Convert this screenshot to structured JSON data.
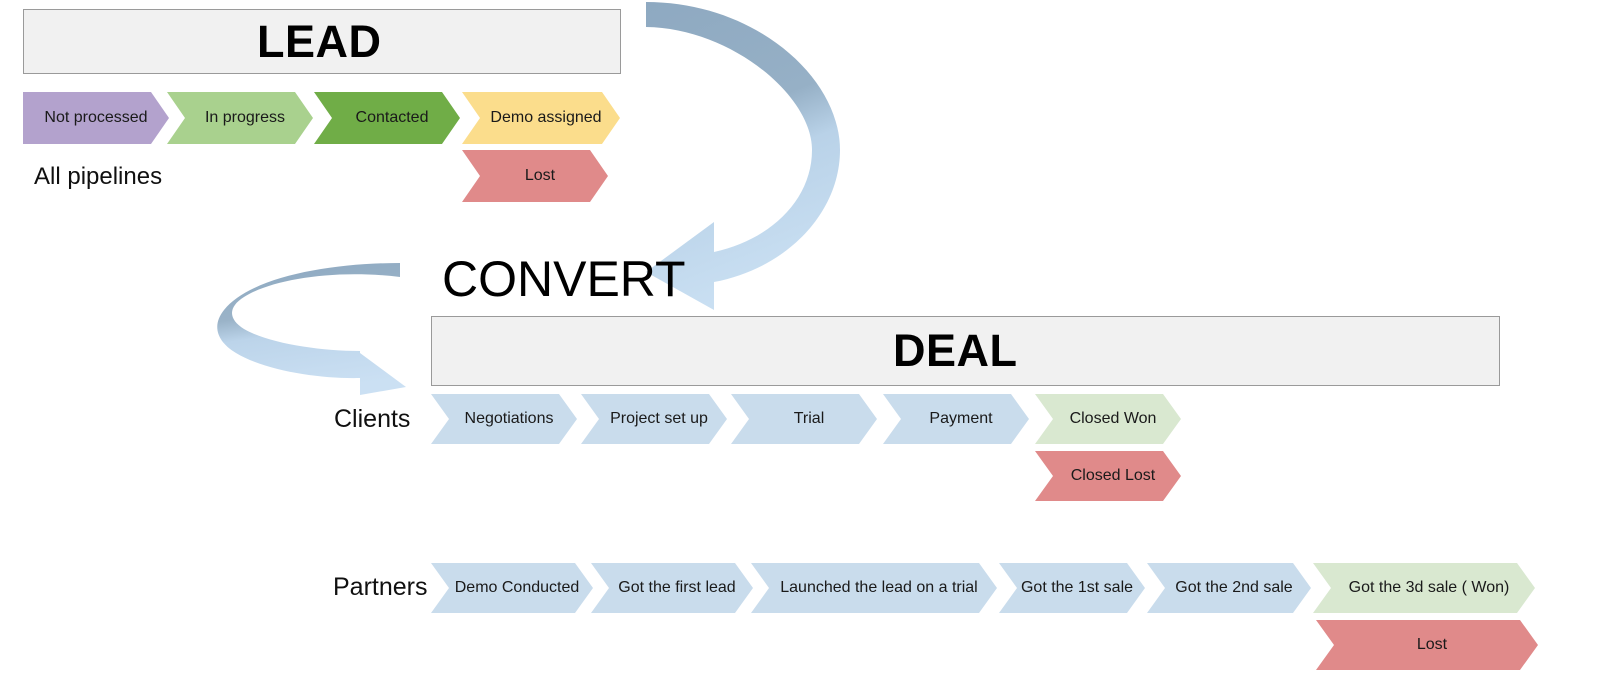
{
  "diagram": {
    "title_words": {
      "lead": "LEAD",
      "convert": "CONVERT",
      "deal": "DEAL"
    },
    "row_labels": {
      "all_pipelines": "All pipelines",
      "clients": "Clients",
      "partners": "Partners"
    },
    "colors": {
      "purple": "#b3a2cd",
      "light_green": "#a9d18e",
      "dark_green": "#70ad47",
      "yellow": "#fbdd8c",
      "red": "#e08a8a",
      "blue": "#c9dcec",
      "pale_green": "#d9e8d0",
      "box_fill": "#f1f1f1",
      "box_border": "#9a9a9a",
      "arrow_dark": "#8ea9c1",
      "arrow_light": "#c5dcf0"
    },
    "lead_stages": [
      {
        "label": "Not processed",
        "color": "#b3a2cd"
      },
      {
        "label": "In progress",
        "color": "#a9d18e"
      },
      {
        "label": "Contacted",
        "color": "#70ad47"
      },
      {
        "label": "Demo assigned",
        "color": "#fbdd8c"
      }
    ],
    "lead_lost": {
      "label": "Lost",
      "color": "#e08a8a"
    },
    "client_stages": [
      {
        "label": "Negotiations",
        "color": "#c9dcec"
      },
      {
        "label": "Project set up",
        "color": "#c9dcec"
      },
      {
        "label": "Trial",
        "color": "#c9dcec"
      },
      {
        "label": "Payment",
        "color": "#c9dcec"
      },
      {
        "label": "Closed Won",
        "color": "#d9e8d0"
      }
    ],
    "client_lost": {
      "label": "Closed Lost",
      "color": "#e08a8a"
    },
    "partner_stages": [
      {
        "label": "Demo Conducted",
        "color": "#c9dcec"
      },
      {
        "label": "Got the first lead",
        "color": "#c9dcec"
      },
      {
        "label": "Launched the lead on a trial",
        "color": "#c9dcec"
      },
      {
        "label": "Got the 1st sale",
        "color": "#c9dcec"
      },
      {
        "label": "Got the 2nd sale",
        "color": "#c9dcec"
      },
      {
        "label": "Got the 3d sale ( Won)",
        "color": "#d9e8d0"
      }
    ],
    "partner_lost": {
      "label": "Lost",
      "color": "#e08a8a"
    },
    "arrows": [
      {
        "name": "lead-to-convert-arrow",
        "direction": "down-left"
      },
      {
        "name": "convert-to-deal-arrow",
        "direction": "down-right"
      }
    ]
  }
}
